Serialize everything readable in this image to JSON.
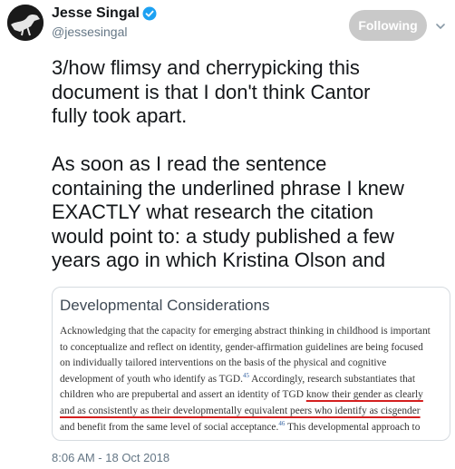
{
  "user": {
    "display_name": "Jesse Singal",
    "handle": "@jessesingal",
    "verified": true,
    "avatar_icon": "profile-photo-silhouette-icon"
  },
  "follow_button": {
    "label": "Following"
  },
  "tweet": {
    "paragraphs": [
      "3/how flimsy and cherrypicking this\ndocument is that I don't think Cantor\nfully took apart.",
      "As soon as I read the sentence\ncontaining the underlined phrase I knew\nEXACTLY what research the citation\nwould point to: a study published a few\nyears ago in which Kristina Olson and"
    ],
    "timestamp": "8:06 AM - 18 Oct 2018"
  },
  "embedded_image": {
    "title": "Developmental Considerations",
    "lines": {
      "l1": "Acknowledging that the capacity for emerging abstract thinking in childhood is important",
      "l2": "to conceptualize and reflect on identity, gender-affirmation guidelines are being focused",
      "l3": "on individually tailored interventions on the basis of the physical and cognitive",
      "l4a": "development of youth who identify as TGD.",
      "l4sup": "45",
      "l4b": " Accordingly, research substantiates that",
      "l5a": "children who are prepubertal and assert an identity of TGD ",
      "l5u": "know their gender as clearly",
      "l6u": "and as consistently as their developmentally equivalent peers who identify as cisgender",
      "l7a": "and benefit from the same level of social acceptance.",
      "l7sup": "46",
      "l7b": " This developmental approach to"
    },
    "underline_color": "#d41f1f"
  },
  "colors": {
    "follow_button_bg": "#c9c9c9",
    "verified_badge": "#1da1f2",
    "secondary_text": "#657786"
  }
}
